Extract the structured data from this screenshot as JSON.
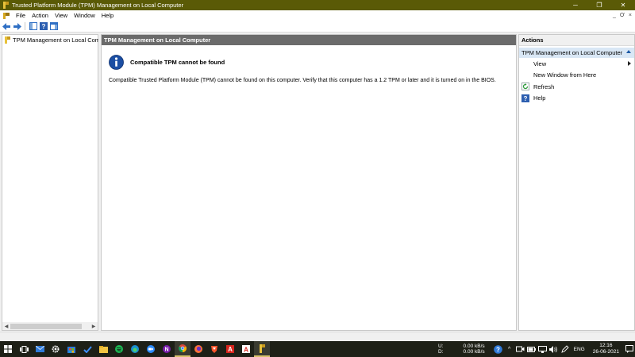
{
  "window": {
    "title": "Trusted Platform Module (TPM) Management on Local Computer",
    "controls": {
      "minimize": "─",
      "restore": "❐",
      "close": "✕"
    }
  },
  "menu": {
    "items": [
      "File",
      "Action",
      "View",
      "Window",
      "Help"
    ],
    "inner_controls": {
      "minimize": "_",
      "restore": "Ơ",
      "close": "×"
    }
  },
  "toolbar": {
    "buttons": [
      "back-icon",
      "forward-icon",
      "show-hide-tree-icon",
      "help-icon",
      "show-hide-action-pane-icon"
    ]
  },
  "tree": {
    "root_label": "TPM Management on Local Comp"
  },
  "content": {
    "header": "TPM Management on Local Computer",
    "message_title": "Compatible TPM cannot be found",
    "message_body": "Compatible Trusted Platform Module (TPM) cannot be found on this computer. Verify that this computer has a 1.2 TPM or later and it is turned on in the BIOS."
  },
  "actions": {
    "header": "Actions",
    "section_title": "TPM Management on Local Computer",
    "items": [
      {
        "label": "View",
        "icon": "",
        "has_submenu": true
      },
      {
        "label": "New Window from Here",
        "icon": "",
        "has_submenu": false
      },
      {
        "label": "Refresh",
        "icon": "refresh-icon",
        "has_submenu": false
      },
      {
        "label": "Help",
        "icon": "help-icon",
        "has_submenu": false
      }
    ]
  },
  "taskbar": {
    "apps": [
      "start-icon",
      "task-view-icon",
      "mail-icon",
      "settings-icon",
      "store-icon",
      "tasks-icon",
      "file-explorer-icon",
      "spotify-icon",
      "edge-icon",
      "zoom-icon",
      "onenote-icon",
      "chrome-icon",
      "firefox-icon",
      "brave-icon",
      "acrobat-icon",
      "acrobat-reader-icon",
      "tpm-icon"
    ],
    "network": {
      "up_label": "U:",
      "up_value": "0.00 kB/s",
      "down_label": "D:",
      "down_value": "0.00 kB/s"
    },
    "language": "ENG",
    "time": "12:16",
    "date": "26-06-2021"
  },
  "colors": {
    "titlebar": "#5a5a06",
    "content_header": "#6b6b6b",
    "actions_section": "#d9e7f5",
    "taskbar": "#1e2017",
    "info_blue": "#1b4ea3"
  }
}
